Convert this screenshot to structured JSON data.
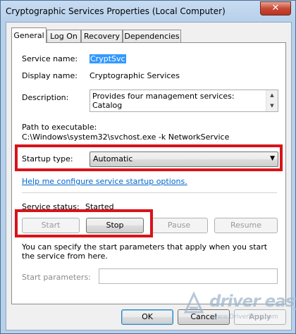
{
  "window": {
    "title": "Cryptographic Services Properties (Local Computer)",
    "close_glyph": "✕"
  },
  "tabs": [
    "General",
    "Log On",
    "Recovery",
    "Dependencies"
  ],
  "general": {
    "service_name_label": "Service name:",
    "service_name_value": "CryptSvc",
    "display_name_label": "Display name:",
    "display_name_value": "Cryptographic Services",
    "description_label": "Description:",
    "description_value": "Provides four management services: Catalog\nDatabase Service, which confirms the signatures of",
    "path_label": "Path to executable:",
    "path_value": "C:\\Windows\\system32\\svchost.exe -k NetworkService",
    "startup_type_label": "Startup type:",
    "startup_type_value": "Automatic",
    "help_link": "Help me configure service startup options.",
    "service_status_label": "Service status:",
    "service_status_value": "Started",
    "buttons": {
      "start": "Start",
      "stop": "Stop",
      "pause": "Pause",
      "resume": "Resume"
    },
    "params_note": "You can specify the start parameters that apply when you start the service from here.",
    "start_params_label": "Start parameters:",
    "start_params_value": ""
  },
  "dialog_buttons": {
    "ok": "OK",
    "cancel": "Cancel",
    "apply": "Apply"
  },
  "watermark": {
    "name": "driver easy",
    "url": "www.DriverEasy.com"
  },
  "colors": {
    "highlight": "#d7141a",
    "selection": "#3399ff",
    "link": "#0066cc"
  }
}
